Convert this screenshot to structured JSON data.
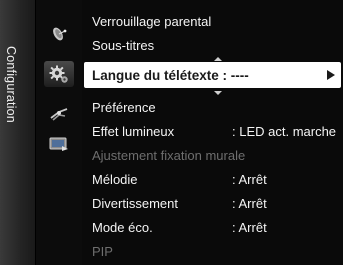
{
  "category": {
    "label": "Configuration"
  },
  "sidebar_icons": [
    {
      "name": "satellite-dish-icon",
      "active": false
    },
    {
      "name": "gear-icon",
      "active": true
    },
    {
      "name": "antenna-icon",
      "active": false
    },
    {
      "name": "input-source-icon",
      "active": false
    }
  ],
  "menu": {
    "items": [
      {
        "label": "Verrouillage parental",
        "value": "",
        "state": "normal"
      },
      {
        "label": "Sous-titres",
        "value": "",
        "state": "normal"
      },
      {
        "label": "Langue du télétexte : ----",
        "value": "",
        "state": "selected"
      },
      {
        "label": "Préférence",
        "value": "",
        "state": "normal"
      },
      {
        "label": "Effet lumineux",
        "value": ": LED act. marche",
        "state": "normal"
      },
      {
        "label": "Ajustement fixation murale",
        "value": "",
        "state": "disabled"
      },
      {
        "label": "Mélodie",
        "value": ": Arrêt",
        "state": "normal"
      },
      {
        "label": "Divertissement",
        "value": ": Arrêt",
        "state": "normal"
      },
      {
        "label": "Mode éco.",
        "value": ": Arrêt",
        "state": "normal"
      },
      {
        "label": "PIP",
        "value": "",
        "state": "disabled"
      }
    ]
  },
  "colors": {
    "background": "#0a0a0a",
    "selected_bg": "#ffffff",
    "text": "#f4f4f4",
    "disabled_text": "#6e6e6e"
  }
}
